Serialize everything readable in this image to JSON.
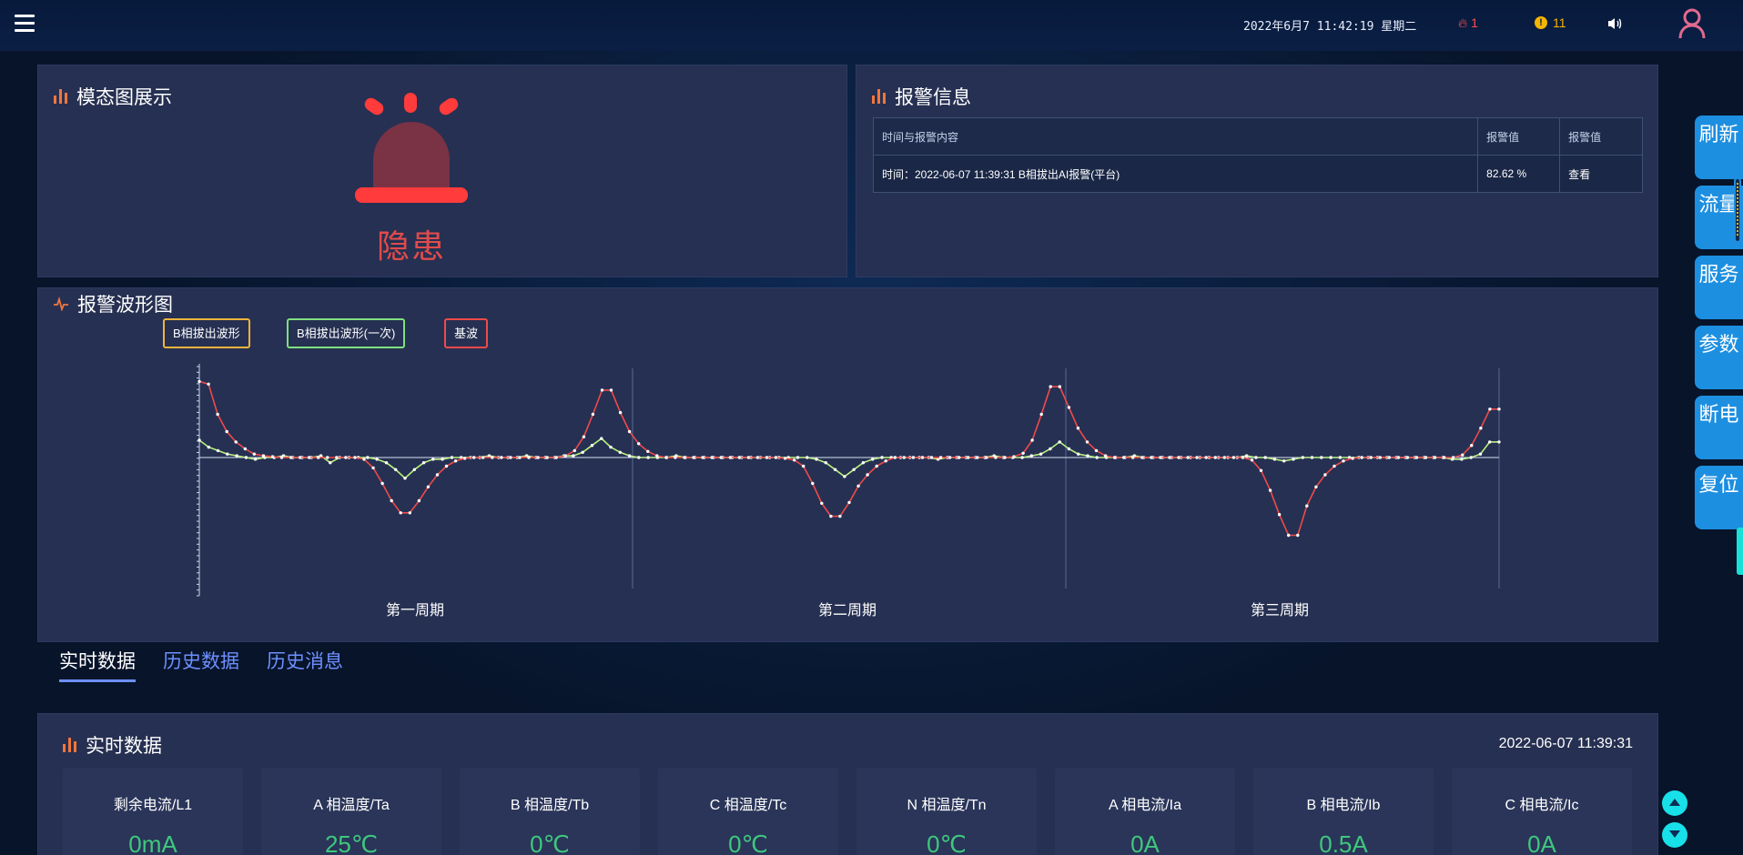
{
  "header": {
    "datetime": "2022年6月7 11:42:19 星期二",
    "fire_count": "1",
    "warn_count": "11",
    "icons": {
      "menu": "hamburger-icon",
      "fire": "fire-icon",
      "warning": "exclamation-icon",
      "sound": "speaker-icon",
      "user": "user-icon"
    }
  },
  "modal_panel": {
    "title": "模态图展示",
    "state": "隐患",
    "siren_color": "#ff3b3b"
  },
  "alarm_panel": {
    "title": "报警信息",
    "headers": [
      "时间与报警内容",
      "报警值",
      "报警值"
    ],
    "rows": [
      {
        "content": "时间：2022-06-07 11:39:31 B相拔出AI报警(平台)",
        "value": "82.62 %",
        "action": "查看"
      }
    ]
  },
  "wave_panel": {
    "title": "报警波形图",
    "legend": [
      {
        "label": "B相拔出波形",
        "color": "#f2b43c"
      },
      {
        "label": "B相拔出波形(一次)",
        "color": "#b9f27c"
      },
      {
        "label": "基波",
        "color": "#f04a4a"
      }
    ],
    "periods": [
      "第一周期",
      "第二周期",
      "第三周期"
    ]
  },
  "chart_data": {
    "type": "line",
    "x_groups": [
      "第一周期",
      "第二周期",
      "第三周期"
    ],
    "ylim": [
      -1,
      1
    ],
    "grid": false,
    "series": [
      {
        "name": "B相拔出波形",
        "color": "#f04a4a",
        "values": [
          0.88,
          0.85,
          0.5,
          0.3,
          0.18,
          0.1,
          0.04,
          0.02,
          0.01,
          0.0,
          0.0,
          0.0,
          0.0,
          0.0,
          0.0,
          0.0,
          0.0,
          0.0,
          -0.02,
          -0.12,
          -0.3,
          -0.5,
          -0.64,
          -0.64,
          -0.5,
          -0.34,
          -0.2,
          -0.1,
          -0.04,
          -0.01,
          0.0,
          0.0,
          0.0,
          0.0,
          0.0,
          0.0,
          0.0,
          0.0,
          0.0,
          0.0,
          0.02,
          0.08,
          0.24,
          0.5,
          0.78,
          0.78,
          0.52,
          0.3,
          0.16,
          0.07,
          0.02,
          0.0,
          0.0,
          0.0,
          0.0,
          0.0,
          0.0,
          0.0,
          0.0,
          0.0,
          0.0,
          0.0,
          0.0,
          0.0,
          -0.01,
          -0.03,
          -0.1,
          -0.3,
          -0.53,
          -0.68,
          -0.68,
          -0.52,
          -0.33,
          -0.2,
          -0.1,
          -0.04,
          0.0,
          0.0,
          0.0,
          0.0,
          0.0,
          0.0,
          0.0,
          0.0,
          0.0,
          0.0,
          0.0,
          0.0,
          0.0,
          0.01,
          0.05,
          0.2,
          0.5,
          0.82,
          0.82,
          0.58,
          0.34,
          0.18,
          0.08,
          0.02,
          0.0,
          0.0,
          0.0,
          0.0,
          0.0,
          0.0,
          0.0,
          0.0,
          0.0,
          0.0,
          0.0,
          0.0,
          0.0,
          0.0,
          0.0,
          -0.03,
          -0.15,
          -0.38,
          -0.66,
          -0.9,
          -0.9,
          -0.56,
          -0.34,
          -0.2,
          -0.1,
          -0.04,
          -0.01,
          0.0,
          0.0,
          0.0,
          0.0,
          0.0,
          0.0,
          0.0,
          0.0,
          0.0,
          0.0,
          0.0,
          0.03,
          0.14,
          0.34,
          0.56,
          0.56
        ]
      },
      {
        "name": "B相拔出波形(一次)",
        "color": "#b9f27c",
        "values": [
          0.2,
          0.12,
          0.08,
          0.04,
          0.02,
          0.0,
          -0.02,
          0.0,
          0.0,
          0.02,
          0.0,
          0.0,
          0.0,
          0.02,
          -0.06,
          0.0,
          0.0,
          0.0,
          0.0,
          -0.02,
          -0.06,
          -0.14,
          -0.24,
          -0.14,
          -0.06,
          -0.02,
          -0.02,
          0.0,
          0.0,
          0.0,
          0.0,
          0.02,
          0.0,
          0.0,
          0.0,
          0.02,
          0.0,
          0.0,
          0.0,
          0.02,
          0.02,
          0.06,
          0.14,
          0.22,
          0.12,
          0.06,
          0.02,
          0.0,
          0.0,
          0.0,
          0.0,
          0.02,
          0.0,
          0.0,
          0.0,
          0.0,
          0.0,
          0.0,
          0.0,
          0.0,
          0.0,
          0.0,
          0.0,
          0.0,
          0.0,
          0.0,
          -0.02,
          -0.06,
          -0.14,
          -0.22,
          -0.14,
          -0.06,
          -0.02,
          0.0,
          0.0,
          0.0,
          0.0,
          0.0,
          0.0,
          -0.02,
          0.0,
          0.0,
          0.0,
          0.0,
          0.0,
          0.02,
          0.0,
          0.0,
          0.0,
          0.02,
          0.04,
          0.1,
          0.18,
          0.1,
          0.04,
          0.02,
          0.0,
          0.0,
          0.0,
          0.0,
          0.02,
          0.0,
          0.0,
          0.0,
          0.0,
          0.0,
          0.0,
          0.0,
          0.0,
          0.0,
          0.0,
          0.0,
          0.02,
          0.0,
          0.0,
          -0.02,
          -0.04,
          -0.02,
          0.0,
          0.0,
          0.0,
          0.0,
          0.0,
          0.0,
          0.0,
          0.0,
          0.0,
          0.0,
          0.0,
          0.0,
          0.0,
          0.0,
          0.0,
          0.0,
          -0.02,
          -0.02,
          0.0,
          0.04,
          0.18,
          0.18
        ]
      }
    ]
  },
  "tabs": [
    "实时数据",
    "历史数据",
    "历史消息"
  ],
  "realtime": {
    "title": "实时数据",
    "timestamp": "2022-06-07 11:39:31",
    "cards": [
      {
        "label": "剩余电流/L1",
        "value": "0mA"
      },
      {
        "label": "A 相温度/Ta",
        "value": "25℃"
      },
      {
        "label": "B 相温度/Tb",
        "value": "0℃"
      },
      {
        "label": "C 相温度/Tc",
        "value": "0℃"
      },
      {
        "label": "N 相温度/Tn",
        "value": "0℃"
      },
      {
        "label": "A 相电流/Ia",
        "value": "0A"
      },
      {
        "label": "B 相电流/Ib",
        "value": "0.5A"
      },
      {
        "label": "C 相电流/Ic",
        "value": "0A"
      }
    ]
  },
  "side_menu": [
    "刷新",
    "流量",
    "服务",
    "参数",
    "断电",
    "复位"
  ],
  "colors": {
    "panel": "#263052",
    "accent": "#1d8fe0",
    "value_green": "#3ec87d",
    "alarm_red": "#e14b4b",
    "title_icon": "#f2763b"
  }
}
